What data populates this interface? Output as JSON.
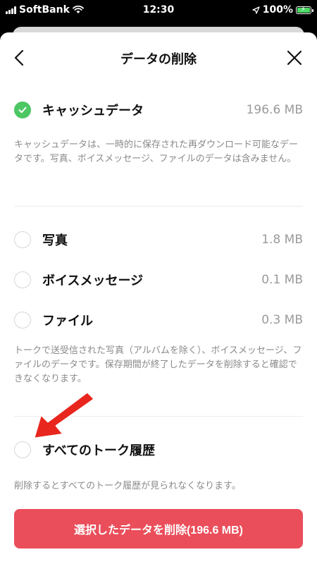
{
  "status_bar": {
    "carrier": "SoftBank",
    "time": "12:30",
    "battery": "100%"
  },
  "header": {
    "title": "データの削除"
  },
  "cache": {
    "label": "キャッシュデータ",
    "size": "196.6 MB",
    "checked": true,
    "description": "キャッシュデータは、一時的に保存された再ダウンロード可能なデータです。写真、ボイスメッセージ、ファイルのデータは含みません。"
  },
  "media_items": [
    {
      "label": "写真",
      "size": "1.8 MB",
      "checked": false
    },
    {
      "label": "ボイスメッセージ",
      "size": "0.1 MB",
      "checked": false
    },
    {
      "label": "ファイル",
      "size": "0.3 MB",
      "checked": false
    }
  ],
  "media_description": "トークで送受信された写真（アルバムを除く）、ボイスメッセージ、ファイルのデータです。保存期間が終了したデータを削除すると確認できなくなります。",
  "history": {
    "label": "すべてのトーク履歴",
    "checked": false,
    "description": "削除するとすべてのトーク履歴が見られなくなります。"
  },
  "delete_button": {
    "label": "選択したデータを削除(196.6 MB)"
  },
  "colors": {
    "accent_green": "#4cc764",
    "delete_red": "#ea4e5a",
    "annotation_arrow": "#e8261e"
  },
  "icons": {
    "back": "chevron-left-icon",
    "close": "close-icon",
    "check": "check-icon",
    "wifi": "wifi-icon",
    "location": "location-arrow-icon",
    "battery": "battery-charging-icon"
  }
}
